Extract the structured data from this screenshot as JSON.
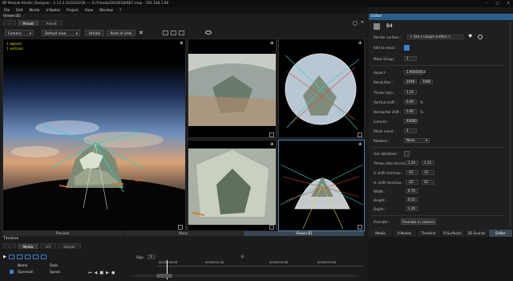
{
  "window": {
    "title": "BP Module Kinetic Designer - 2.13.3 12/03/2018 ---- E:/Vinodo/2018018/NEC.mxp - 192.168.1.66",
    "controls": [
      "–",
      "□",
      "✕"
    ]
  },
  "menu": [
    "File",
    "Edit",
    "Media",
    "V-Nodes",
    "Project",
    "View",
    "Window",
    "?"
  ],
  "viewer": {
    "title": "Viewer3D",
    "tabs": [
      "Preset",
      "Preset"
    ],
    "camera_select": "Camera",
    "view_select": "Default view",
    "orbital_button": "Orbital",
    "pov_button": "Point of view",
    "overlay_lines": [
      "1 objects",
      "1 vertices"
    ],
    "bottom_tabs": [
      "Preview",
      "Warp",
      "Viewer3D"
    ]
  },
  "editor": {
    "title": "Editor",
    "object_name": "B4",
    "fields": {
      "render_surface_label": "Render surface :",
      "render_surface_value": "< Use a unique surface >",
      "add_to_mask_label": "Add to mask :",
      "mask_group_label": "Mask Group :",
      "mask_group_value": "1",
      "aspect_label": "Aspect :",
      "aspect_value": "1.90000010",
      "resolution_label": "Resolution :",
      "resolution_w": "2048",
      "resolution_h": "1080",
      "throw_ratio_label": "Throw ratio :",
      "throw_ratio_value": "1.24",
      "vertical_shift_label": "Vertical shift :",
      "vertical_shift_value": "0.00",
      "horizontal_shift_label": "Horizontal shift :",
      "horizontal_shift_value": "0.00",
      "lumens_label": "Lumens :",
      "lumens_value": "40000",
      "stack_count_label": "Stack count :",
      "stack_count_value": "1",
      "rotation_label": "Rotation :",
      "rotation_value": "None",
      "use_database_label": "Use database :",
      "throw_ratio_minmax_label": "Throw ratio min/max :",
      "throw_ratio_min": "1.24",
      "throw_ratio_max": "1.15",
      "v_shift_label": "V. shift min/max :",
      "v_shift_min": "-15",
      "v_shift_max": "15",
      "h_shift_label": "H. shift min/max :",
      "h_shift_min": "-22",
      "h_shift_max": "22",
      "width_label": "Width :",
      "width_value": "0.70",
      "height_label": "Height :",
      "height_value": "0.52",
      "depth_label": "Depth :",
      "depth_value": "1.16",
      "percent_unit": "%",
      "promote_label": "Promote :",
      "promote_button": "Promote in camera"
    },
    "bottom_tabs": [
      "Media",
      "V-Nodes",
      "Timeline",
      "R-Surfaces",
      "3D Scenes",
      "Editor"
    ]
  },
  "timeline": {
    "title": "Timeline",
    "tabs": [
      "Media",
      "UV",
      "Simple"
    ],
    "columns": [
      "Name",
      "Data"
    ],
    "row_name": "Openwall",
    "row_data": "Speak",
    "time_labels": [
      "00:00:00:00",
      "00:00:00:00",
      "00:00:01:00",
      "00:00:02:00",
      "00:00:03:00",
      "00:00:04:00",
      "00:00:05:00",
      "00:00:06:00",
      "00:00:07:00"
    ],
    "speed_label": "Skip",
    "speed_value": "1"
  },
  "colors": {
    "accent": "#2b5f8a",
    "selection": "#4a86b5",
    "swatch": "#3b7fd0",
    "overlay_text": "#d8d800"
  }
}
